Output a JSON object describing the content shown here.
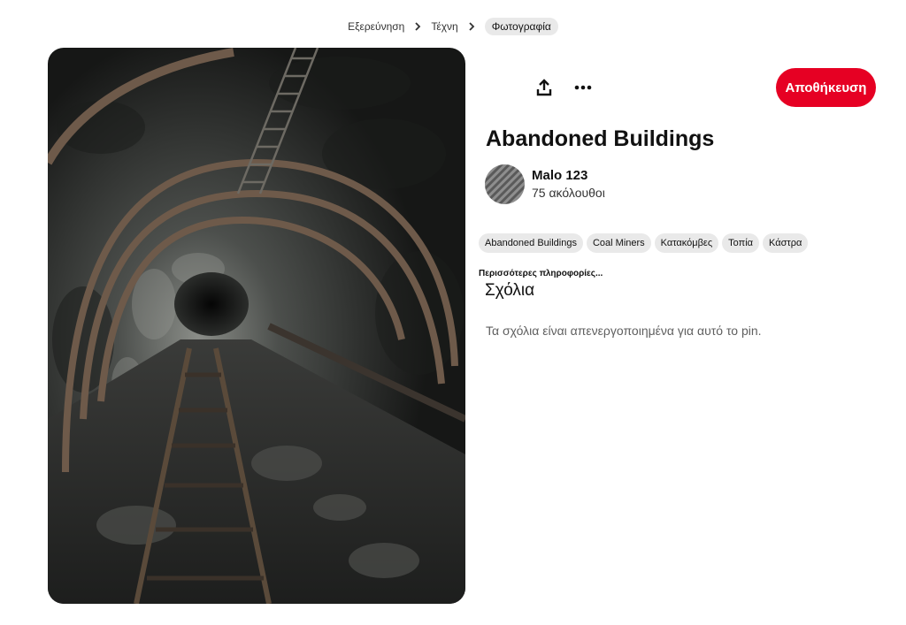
{
  "breadcrumb": {
    "items": [
      {
        "label": "Εξερεύνηση"
      },
      {
        "label": "Τέχνη"
      },
      {
        "label": "Φωτογραφία"
      }
    ]
  },
  "pin": {
    "image_icon": "mine-tunnel-photo",
    "title": "Abandoned Buildings"
  },
  "toolbar": {
    "share_icon": "share-icon",
    "more_icon": "more-options-icon",
    "save_label": "Αποθήκευση",
    "save_color": "#e60023"
  },
  "creator": {
    "name": "Malo 123",
    "followers": "75 ακόλουθοι"
  },
  "tags": [
    {
      "label": "Abandoned Buildings"
    },
    {
      "label": "Coal Miners"
    },
    {
      "label": "Κατακόμβες"
    },
    {
      "label": "Τοπία"
    },
    {
      "label": "Κάστρα"
    }
  ],
  "more_info_label": "Περισσότερες πληροφορίες...",
  "comments": {
    "heading": "Σχόλια",
    "disabled_message": "Τα σχόλια είναι απενεργοποιημένα για αυτό το pin."
  }
}
